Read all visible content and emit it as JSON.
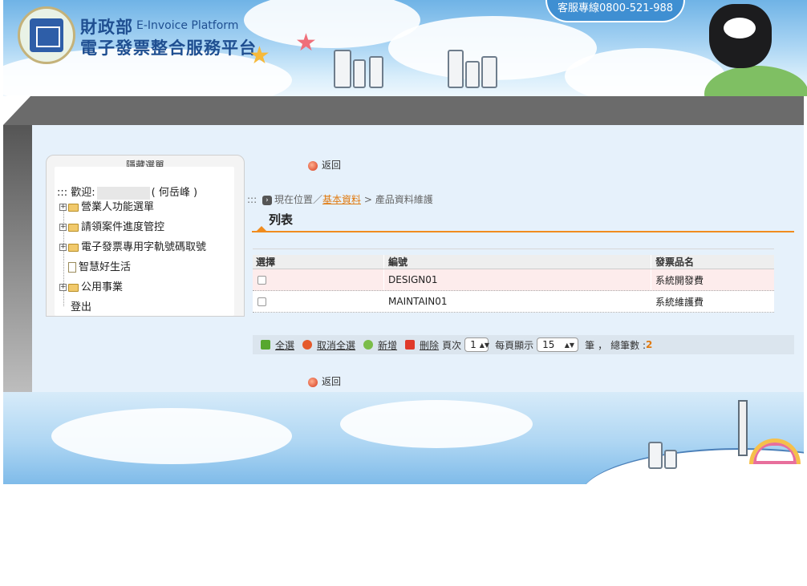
{
  "header": {
    "title_main": "財政部",
    "title_sub_en": "E-Invoice Platform",
    "title_cn": "電子發票整合服務平台",
    "hotline": "客服專線0800-521-988"
  },
  "sidebar": {
    "toggle_label": "隱藏選單",
    "welcome_prefix": "::: 歡迎:",
    "user_name": "( 何岳峰 )",
    "items": [
      {
        "label": "營業人功能選單",
        "type": "folder"
      },
      {
        "label": "請領案件進度管控",
        "type": "folder"
      },
      {
        "label": "電子發票專用字軌號碼取號",
        "type": "folder"
      },
      {
        "label": "智慧好生活",
        "type": "doc"
      },
      {
        "label": "公用事業",
        "type": "folder"
      },
      {
        "label": "登出",
        "type": "leaf"
      }
    ]
  },
  "main": {
    "back_label": "返回",
    "breadcrumb": {
      "prefix": ":::",
      "current": "現在位置／",
      "link": "基本資料",
      "sep": " > ",
      "page": "產品資料維護"
    },
    "list_title": "列表",
    "table": {
      "columns": [
        "選擇",
        "編號",
        "發票品名"
      ],
      "rows": [
        {
          "code": "DESIGN01",
          "name": "系統開發費"
        },
        {
          "code": "MAINTAIN01",
          "name": "系統維護費"
        }
      ]
    },
    "toolbar": {
      "select_all": "全選",
      "deselect_all": "取消全選",
      "add": "新增",
      "delete": "刪除",
      "page_label": "頁次",
      "page_value": "1",
      "per_page_label": "每頁顯示",
      "per_page_value": "15",
      "unit": "筆",
      "comma": "，",
      "total_label": "總筆數 :",
      "total_value": "2"
    }
  },
  "colors": {
    "accent": "#f08c1e",
    "link": "#e07a10",
    "header_text": "#1f4f91",
    "hotline_bg": "#3f8fd2"
  }
}
